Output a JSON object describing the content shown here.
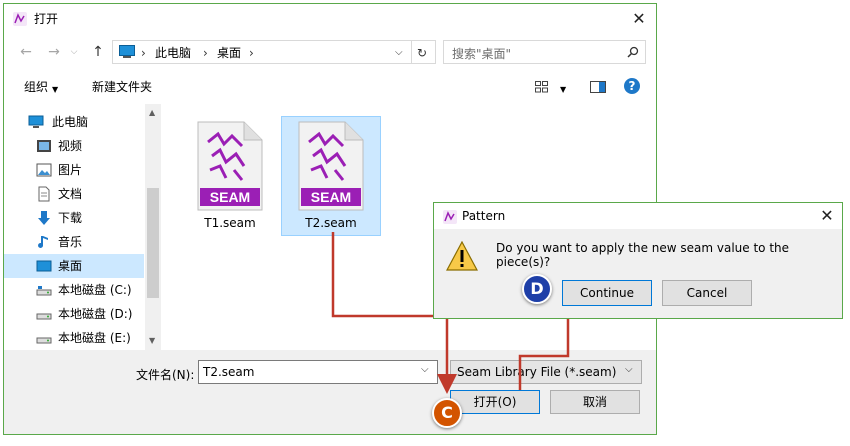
{
  "open_dialog": {
    "title": "打开",
    "address": {
      "segments": [
        "此电脑",
        "桌面"
      ]
    },
    "search_placeholder": "搜索\"桌面\"",
    "toolbar": {
      "organize": "组织",
      "new_folder": "新建文件夹"
    },
    "nav_items": [
      {
        "label": "此电脑",
        "icon": "computer-icon"
      },
      {
        "label": "视频",
        "icon": "video-icon"
      },
      {
        "label": "图片",
        "icon": "picture-icon"
      },
      {
        "label": "文档",
        "icon": "document-icon"
      },
      {
        "label": "下载",
        "icon": "download-icon"
      },
      {
        "label": "音乐",
        "icon": "music-icon"
      },
      {
        "label": "桌面",
        "icon": "desktop-icon",
        "selected": true
      },
      {
        "label": "本地磁盘 (C:)",
        "icon": "drive-icon"
      },
      {
        "label": "本地磁盘 (D:)",
        "icon": "drive-icon"
      },
      {
        "label": "本地磁盘 (E:)",
        "icon": "drive-icon"
      }
    ],
    "files": [
      {
        "name": "T1.seam",
        "badge": "SEAM",
        "selected": false
      },
      {
        "name": "T2.seam",
        "badge": "SEAM",
        "selected": true
      }
    ],
    "filename_label": "文件名(N):",
    "filename_value": "T2.seam",
    "filetype_value": "Seam Library File (*.seam)",
    "open_button": "打开(O)",
    "cancel_button": "取消"
  },
  "pattern_dialog": {
    "title": "Pattern",
    "message": "Do you want to apply the new seam value to the piece(s)?",
    "continue_button": "Continue",
    "cancel_button": "Cancel"
  },
  "annotations": {
    "step_c": "C",
    "step_d": "D"
  },
  "colors": {
    "accent_border": "#5aa84a",
    "selection": "#cce8ff",
    "seam_purple": "#9b1fb5",
    "arrow": "#c0392b"
  }
}
